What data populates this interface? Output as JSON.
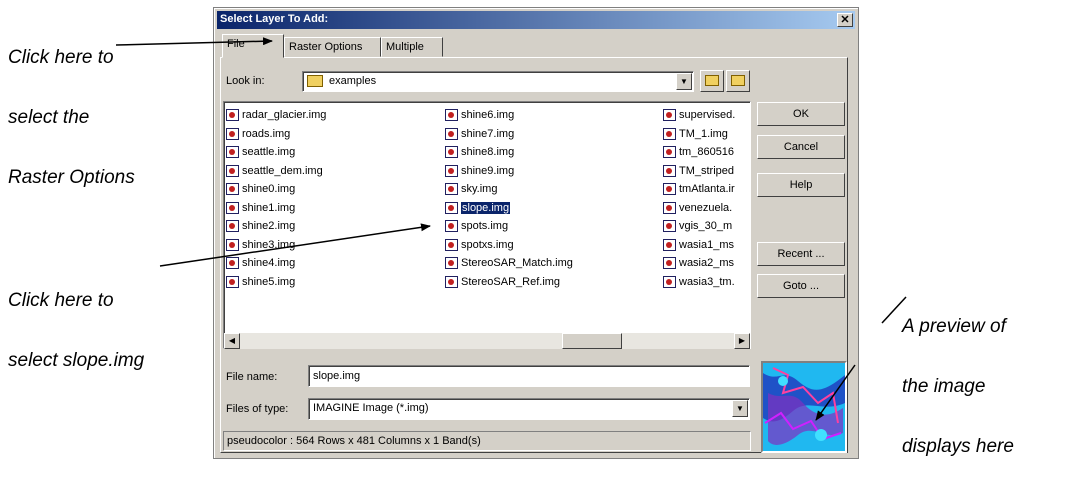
{
  "callouts": {
    "raster_options": [
      "Click here to",
      "select the",
      "Raster Options"
    ],
    "slope": [
      "Click here to",
      "select slope.img"
    ],
    "preview": [
      "A preview of",
      "the image",
      "displays here"
    ]
  },
  "dialog": {
    "title": "Select Layer To Add:",
    "close_label": "✕",
    "tabs": [
      "File",
      "Raster Options",
      "Multiple"
    ],
    "look_in_label": "Look in:",
    "look_in_value": "examples",
    "files": {
      "col1": [
        "radar_glacier.img",
        "roads.img",
        "seattle.img",
        "seattle_dem.img",
        "shine0.img",
        "shine1.img",
        "shine2.img",
        "shine3.img",
        "shine4.img",
        "shine5.img"
      ],
      "col2": [
        "shine6.img",
        "shine7.img",
        "shine8.img",
        "shine9.img",
        "sky.img",
        "slope.img",
        "spots.img",
        "spotxs.img",
        "StereoSAR_Match.img",
        "StereoSAR_Ref.img"
      ],
      "col3": [
        "supervised.",
        "TM_1.img",
        "tm_860516",
        "TM_striped",
        "tmAtlanta.ir",
        "venezuela.",
        "vgis_30_m",
        "wasia1_ms",
        "wasia2_ms",
        "wasia3_tm."
      ]
    },
    "selected_file": "slope.img",
    "buttons": {
      "ok": "OK",
      "cancel": "Cancel",
      "help": "Help",
      "recent": "Recent ...",
      "goto": "Goto ..."
    },
    "file_name_label": "File name:",
    "file_name_value": "slope.img",
    "file_type_label": "Files of type:",
    "file_type_value": "IMAGINE Image (*.img)",
    "status": "pseudocolor : 564 Rows x 481 Columns x 1 Band(s)"
  },
  "colors": {
    "title_bar": "#0a246a",
    "selection": "#0a246a",
    "preview_bg": "#00c8ff"
  }
}
